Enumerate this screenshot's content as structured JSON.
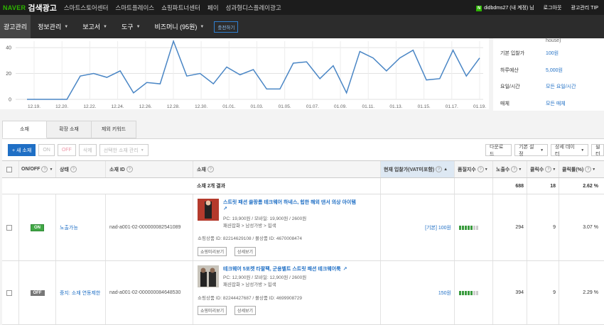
{
  "topbar": {
    "naver": "NAVER",
    "brand": "검색광고",
    "links": [
      "스마트스토어센터",
      "스마트플레이스",
      "쇼핑파트너센터",
      "페이",
      "성과형디스플레이광고"
    ],
    "user_badge": "N",
    "user": "didbdms27 (내 계정) 님",
    "logout": "로그아웃",
    "tip": "광고관리 TIP"
  },
  "menu": {
    "items": [
      "광고관리",
      "정보관리",
      "보고서",
      "도구",
      "비즈머니 (95원)"
    ],
    "charge": "충전하기"
  },
  "chart_data": {
    "type": "line",
    "x": [
      "12.19.",
      "12.20.",
      "12.22.",
      "12.24.",
      "12.26.",
      "12.28.",
      "12.30.",
      "01.01.",
      "01.03.",
      "01.05.",
      "01.07.",
      "01.09.",
      "01.11.",
      "01.13.",
      "01.15.",
      "01.17.",
      "01.19."
    ],
    "y_ticks": [
      0,
      20,
      40
    ],
    "ylim": [
      0,
      45
    ],
    "series": [
      {
        "values": [
          0,
          0,
          0,
          0,
          18,
          20,
          17,
          22,
          5,
          13,
          12,
          45,
          18,
          20,
          12,
          25,
          19,
          23,
          8,
          8,
          28,
          29,
          16,
          26,
          5,
          37,
          32,
          22,
          32,
          38,
          15,
          16,
          38,
          18,
          32
        ]
      }
    ]
  },
  "sidebar": {
    "top": "house)",
    "rows": [
      {
        "label": "기본 입찰가",
        "value": "100원"
      },
      {
        "label": "하루예산",
        "value": "5,000원"
      },
      {
        "label": "요일/시간",
        "value": "모든 요일/시간"
      },
      {
        "label": "매체",
        "value": "모든 매체"
      }
    ]
  },
  "tabs": [
    "소재",
    "확장 소재",
    "제외 키워드"
  ],
  "toolbar": {
    "add": "+ 새 소재",
    "on": "ON",
    "off": "OFF",
    "delete": "삭제",
    "manage": "선택한 소재 관리",
    "filter": "다운로드",
    "basic": "기본 설정",
    "detail": "상세 데이터",
    "more": "필터"
  },
  "table": {
    "headers": {
      "onoff": "ON/OFF",
      "status": "상태",
      "id": "소재 ID",
      "ad": "소재",
      "bid": "현재 입찰가(VAT미포함)",
      "quality": "품질지수",
      "imp": "노출수",
      "click": "클릭수",
      "ctr": "클릭률(%)"
    },
    "summary": {
      "label": "소재 2개 결과",
      "imp": "688",
      "click": "18",
      "ctr": "2.62 %"
    },
    "rows": [
      {
        "onoff": "ON",
        "status": "노출가능",
        "id": "nad-a001-02-000000082541089",
        "title": "스트릿 패션 쓸팡롬 테크웨어 하네스, 힙한 해외 댄서 의상 아이템",
        "price": "PC: 19,900원 / 모바일: 19,900원 / 2600원",
        "category": "패션잡화 > 남성가방 > 힙색",
        "product": "쇼핑상품 ID: 82214629108 / 몰상품 ID: 4670008474",
        "btn1": "쇼핑미리보기",
        "btn2": "상세보기",
        "bid": "[기본] 100원",
        "imp": "294",
        "click": "9",
        "ctr": "3.07 %"
      },
      {
        "onoff": "OFF",
        "status": "중지: 소재 연동제한",
        "id": "nad-a001-02-000000084648530",
        "title": "테크웨어 5포켓 타팔팩, 군용벨트 스트릿 패션 테크웨어룩",
        "price": "PC: 12,900원 / 모바일: 12,900원 / 2600원",
        "category": "패션잡화 > 남성가방 > 힙색",
        "product": "쇼핑상품 ID: 82244427687 / 몰상품 ID: 4699908729",
        "btn1": "쇼핑미리보기",
        "btn2": "상세보기",
        "bid": "150원",
        "imp": "394",
        "click": "9",
        "ctr": "2.29 %"
      }
    ]
  },
  "colors": {
    "accent": "#1f6fc5",
    "on": "#41a846",
    "naver": "#2db400"
  }
}
